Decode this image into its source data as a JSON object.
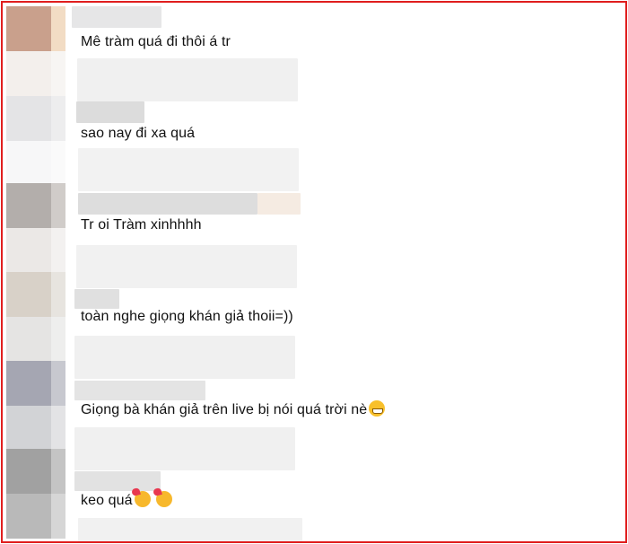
{
  "comments": [
    {
      "text": "Mê tràm quá đi thôi á tr"
    },
    {
      "text": "sao nay đi xa quá"
    },
    {
      "text": "Tr oi Tràm xinhhhh"
    },
    {
      "text": "toàn nghe giọng khán giả thoii=))"
    },
    {
      "text": "Giọng bà khán giả trên live bị nói quá trời nè",
      "emoji": "grinning-face-emoji"
    },
    {
      "text": "keo quá",
      "emoji": "smiling-face-with-hearts-emoji"
    }
  ],
  "colors": {
    "frame_border": "#e01e1e",
    "text": "#111111",
    "blur_light": "#ececec",
    "blur_mid": "#dcdcdc"
  }
}
